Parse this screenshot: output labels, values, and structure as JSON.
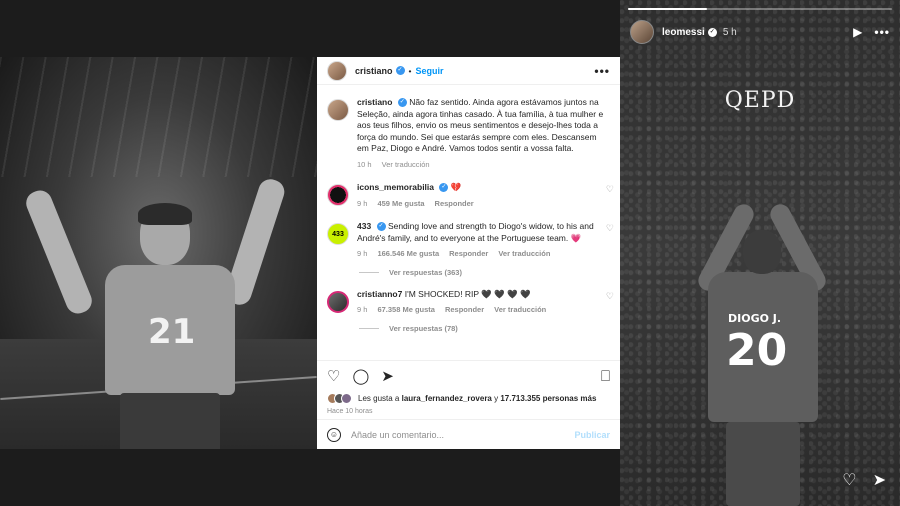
{
  "post": {
    "username": "cristiano",
    "follow_label": "Seguir",
    "more_icon": "more-horizontal-icon",
    "caption": {
      "username": "cristiano",
      "text": "Não faz sentido. Ainda agora estávamos juntos na Seleção, ainda agora tinhas casado. À tua família, à tua mulher e aos teus filhos, envio os meus sentimentos e desejo-lhes toda a força do mundo. Sei que estarás sempre com eles. Descansem em Paz, Diogo e André. Vamos todos sentir a vossa falta.",
      "time": "10 h",
      "translate": "Ver traducción"
    },
    "comments": [
      {
        "username": "icons_memorabilia",
        "text": "💔",
        "time": "9 h",
        "likes": "459 Me gusta",
        "reply": "Responder",
        "translate": ""
      },
      {
        "username": "433",
        "text": "Sending love and strength to Diogo's widow, to his and André's family, and to everyone at the Portuguese team. 💗",
        "time": "9 h",
        "likes": "166.546 Me gusta",
        "reply": "Responder",
        "translate": "Ver traducción",
        "replies": "Ver respuestas (363)"
      },
      {
        "username": "cristianno7",
        "text": "I'M SHOCKED! RIP 🖤 🖤 🖤 🖤",
        "time": "9 h",
        "likes": "67.358 Me gusta",
        "reply": "Responder",
        "translate": "Ver traducción",
        "replies": "Ver respuestas (78)"
      }
    ],
    "likes_prefix": "Les gusta a",
    "likes_user": "laura_fernandez_rovera",
    "likes_and": "y",
    "likes_count": "17.713.355 personas más",
    "time_ago": "Hace 10 horas",
    "comment_placeholder": "Añade un comentario...",
    "publish_label": "Publicar",
    "avatar_433": "433"
  },
  "photo": {
    "shirt_number": "21"
  },
  "story": {
    "username": "leomessi",
    "time": "5 h",
    "progress": 0.3,
    "overlay_text": "QEPD",
    "shirt_name": "DIOGO J.",
    "shirt_number": "20"
  },
  "icons": {
    "verified": "✓",
    "heart": "♡",
    "comment": "◯",
    "share": "➤",
    "save": "⎕",
    "play": "▶",
    "dots": "•••",
    "emoji": "☺"
  }
}
